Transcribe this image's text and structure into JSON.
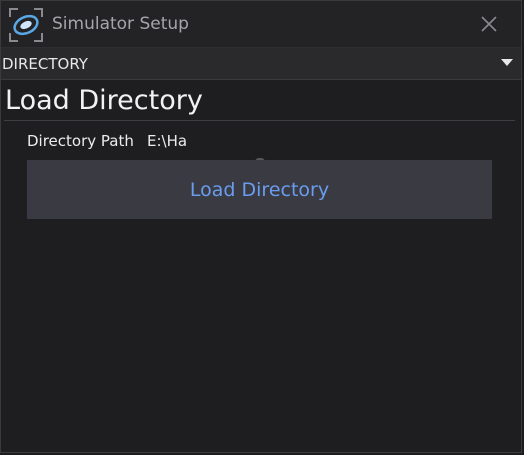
{
  "window": {
    "title": "Simulator Setup",
    "icons": {
      "app": "simulator-logo-icon",
      "close": "close-icon"
    }
  },
  "section": {
    "label": "DIRECTORY",
    "chevron": "chevron-down-icon"
  },
  "panel": {
    "heading": "Load Directory",
    "path_label": "Directory Path",
    "path_value": "E:\\Ha",
    "load_button_label": "Load Directory"
  },
  "colors": {
    "accent": "#6a9cef",
    "background": "#1e1e20",
    "button_bg": "#3a3b42"
  }
}
